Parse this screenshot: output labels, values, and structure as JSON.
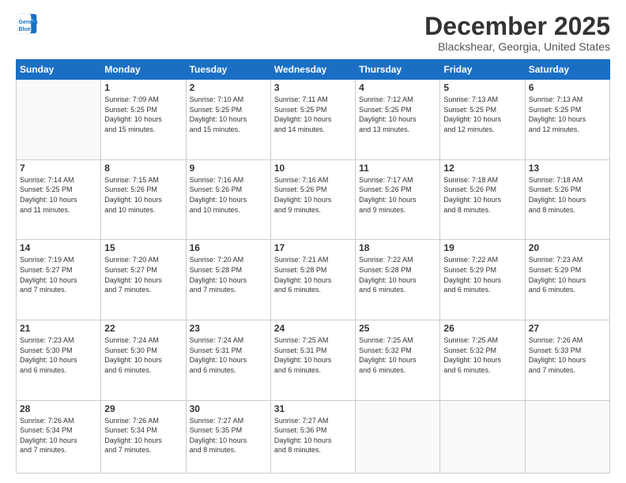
{
  "logo": {
    "line1": "General",
    "line2": "Blue"
  },
  "header": {
    "month": "December 2025",
    "location": "Blackshear, Georgia, United States"
  },
  "days_of_week": [
    "Sunday",
    "Monday",
    "Tuesday",
    "Wednesday",
    "Thursday",
    "Friday",
    "Saturday"
  ],
  "weeks": [
    [
      {
        "day": "",
        "info": ""
      },
      {
        "day": "1",
        "info": "Sunrise: 7:09 AM\nSunset: 5:25 PM\nDaylight: 10 hours\nand 15 minutes."
      },
      {
        "day": "2",
        "info": "Sunrise: 7:10 AM\nSunset: 5:25 PM\nDaylight: 10 hours\nand 15 minutes."
      },
      {
        "day": "3",
        "info": "Sunrise: 7:11 AM\nSunset: 5:25 PM\nDaylight: 10 hours\nand 14 minutes."
      },
      {
        "day": "4",
        "info": "Sunrise: 7:12 AM\nSunset: 5:25 PM\nDaylight: 10 hours\nand 13 minutes."
      },
      {
        "day": "5",
        "info": "Sunrise: 7:13 AM\nSunset: 5:25 PM\nDaylight: 10 hours\nand 12 minutes."
      },
      {
        "day": "6",
        "info": "Sunrise: 7:13 AM\nSunset: 5:25 PM\nDaylight: 10 hours\nand 12 minutes."
      }
    ],
    [
      {
        "day": "7",
        "info": "Sunrise: 7:14 AM\nSunset: 5:25 PM\nDaylight: 10 hours\nand 11 minutes."
      },
      {
        "day": "8",
        "info": "Sunrise: 7:15 AM\nSunset: 5:26 PM\nDaylight: 10 hours\nand 10 minutes."
      },
      {
        "day": "9",
        "info": "Sunrise: 7:16 AM\nSunset: 5:26 PM\nDaylight: 10 hours\nand 10 minutes."
      },
      {
        "day": "10",
        "info": "Sunrise: 7:16 AM\nSunset: 5:26 PM\nDaylight: 10 hours\nand 9 minutes."
      },
      {
        "day": "11",
        "info": "Sunrise: 7:17 AM\nSunset: 5:26 PM\nDaylight: 10 hours\nand 9 minutes."
      },
      {
        "day": "12",
        "info": "Sunrise: 7:18 AM\nSunset: 5:26 PM\nDaylight: 10 hours\nand 8 minutes."
      },
      {
        "day": "13",
        "info": "Sunrise: 7:18 AM\nSunset: 5:26 PM\nDaylight: 10 hours\nand 8 minutes."
      }
    ],
    [
      {
        "day": "14",
        "info": "Sunrise: 7:19 AM\nSunset: 5:27 PM\nDaylight: 10 hours\nand 7 minutes."
      },
      {
        "day": "15",
        "info": "Sunrise: 7:20 AM\nSunset: 5:27 PM\nDaylight: 10 hours\nand 7 minutes."
      },
      {
        "day": "16",
        "info": "Sunrise: 7:20 AM\nSunset: 5:28 PM\nDaylight: 10 hours\nand 7 minutes."
      },
      {
        "day": "17",
        "info": "Sunrise: 7:21 AM\nSunset: 5:28 PM\nDaylight: 10 hours\nand 6 minutes."
      },
      {
        "day": "18",
        "info": "Sunrise: 7:22 AM\nSunset: 5:28 PM\nDaylight: 10 hours\nand 6 minutes."
      },
      {
        "day": "19",
        "info": "Sunrise: 7:22 AM\nSunset: 5:29 PM\nDaylight: 10 hours\nand 6 minutes."
      },
      {
        "day": "20",
        "info": "Sunrise: 7:23 AM\nSunset: 5:29 PM\nDaylight: 10 hours\nand 6 minutes."
      }
    ],
    [
      {
        "day": "21",
        "info": "Sunrise: 7:23 AM\nSunset: 5:30 PM\nDaylight: 10 hours\nand 6 minutes."
      },
      {
        "day": "22",
        "info": "Sunrise: 7:24 AM\nSunset: 5:30 PM\nDaylight: 10 hours\nand 6 minutes."
      },
      {
        "day": "23",
        "info": "Sunrise: 7:24 AM\nSunset: 5:31 PM\nDaylight: 10 hours\nand 6 minutes."
      },
      {
        "day": "24",
        "info": "Sunrise: 7:25 AM\nSunset: 5:31 PM\nDaylight: 10 hours\nand 6 minutes."
      },
      {
        "day": "25",
        "info": "Sunrise: 7:25 AM\nSunset: 5:32 PM\nDaylight: 10 hours\nand 6 minutes."
      },
      {
        "day": "26",
        "info": "Sunrise: 7:25 AM\nSunset: 5:32 PM\nDaylight: 10 hours\nand 6 minutes."
      },
      {
        "day": "27",
        "info": "Sunrise: 7:26 AM\nSunset: 5:33 PM\nDaylight: 10 hours\nand 7 minutes."
      }
    ],
    [
      {
        "day": "28",
        "info": "Sunrise: 7:26 AM\nSunset: 5:34 PM\nDaylight: 10 hours\nand 7 minutes."
      },
      {
        "day": "29",
        "info": "Sunrise: 7:26 AM\nSunset: 5:34 PM\nDaylight: 10 hours\nand 7 minutes."
      },
      {
        "day": "30",
        "info": "Sunrise: 7:27 AM\nSunset: 5:35 PM\nDaylight: 10 hours\nand 8 minutes."
      },
      {
        "day": "31",
        "info": "Sunrise: 7:27 AM\nSunset: 5:36 PM\nDaylight: 10 hours\nand 8 minutes."
      },
      {
        "day": "",
        "info": ""
      },
      {
        "day": "",
        "info": ""
      },
      {
        "day": "",
        "info": ""
      }
    ]
  ]
}
